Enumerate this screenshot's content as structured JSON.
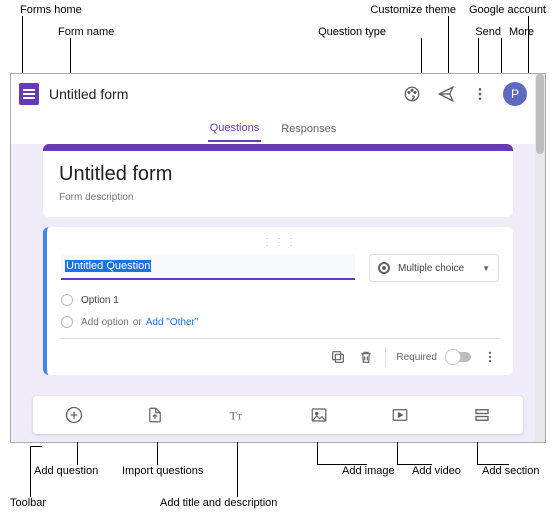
{
  "annotations": {
    "forms_home": "Forms home",
    "form_name": "Form name",
    "customize_theme": "Customize theme",
    "question_type": "Question type",
    "send": "Send",
    "google_account": "Google account",
    "more": "More",
    "add_question": "Add question",
    "import_questions": "Import questions",
    "add_title_desc": "Add title and description",
    "add_image": "Add image",
    "add_video": "Add video",
    "add_section": "Add section",
    "toolbar": "Toolbar"
  },
  "header": {
    "form_name": "Untitled form",
    "avatar_letter": "P"
  },
  "tabs": {
    "questions": "Questions",
    "responses": "Responses"
  },
  "title_card": {
    "title": "Untitled form",
    "description": "Form description"
  },
  "question": {
    "text": "Untitled Question",
    "type_label": "Multiple choice",
    "option1": "Option 1",
    "add_option": "Add option",
    "or": "or",
    "add_other": "Add \"Other\"",
    "required": "Required"
  }
}
